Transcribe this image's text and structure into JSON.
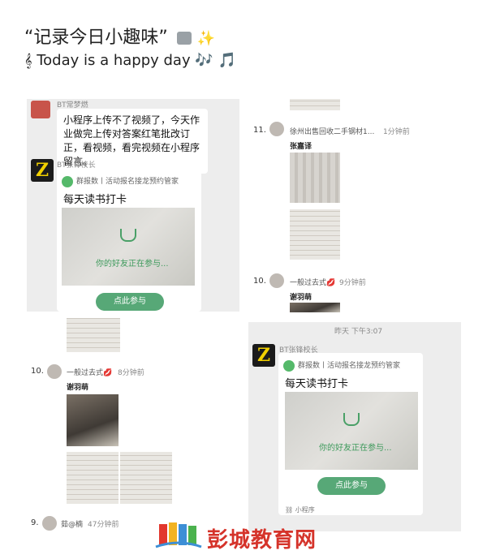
{
  "header": {
    "title": "“记录今日小趣味”",
    "subtitle": "Today is a happy day 🎶 🎵",
    "title_emoji_icons": [
      "camera-icon",
      "sparkles-icon"
    ],
    "subtitle_icon": "music-score-icon"
  },
  "left_chat": {
    "top_sender": "BT常梦燃",
    "message": "小程序上传不了视频了，今天作业做完上传对答案红笔批改订正，看视频，看完视频在小程序留言。",
    "sender2": "BT张锋校长",
    "card": {
      "source": "群报数丨活动报名接龙预约管家",
      "title": "每天读书打卡",
      "image_text": "你的好友正在参与...",
      "button": "点此参与"
    }
  },
  "left_list": {
    "entry10": {
      "num": "10.",
      "name": "一般过去式💋",
      "time": "8分钟前",
      "author": "谢羽萌"
    },
    "entry9": {
      "num": "9.",
      "name": "茹@楠",
      "time": "47分钟前"
    }
  },
  "right_list": {
    "entry11": {
      "num": "11.",
      "name": "徐州出售回收二手钢材1...",
      "time": "1分钟前",
      "author": "张嘉译"
    },
    "entry10": {
      "num": "10.",
      "name": "一般过去式💋",
      "time": "9分钟前",
      "author": "谢羽萌"
    }
  },
  "right_chat": {
    "timestamp": "昨天 下午3:07",
    "sender": "BT张锋校长",
    "card": {
      "source": "群报数丨活动报名接龙预约管家",
      "title": "每天读书打卡",
      "image_text": "你的好友正在参与...",
      "button": "点此参与",
      "footer": "小程序"
    }
  },
  "watermark": {
    "text": "彭城教育网"
  },
  "colors": {
    "accent_green": "#57a877",
    "logo_red": "#d5332a",
    "chat_bg": "#ededed"
  }
}
